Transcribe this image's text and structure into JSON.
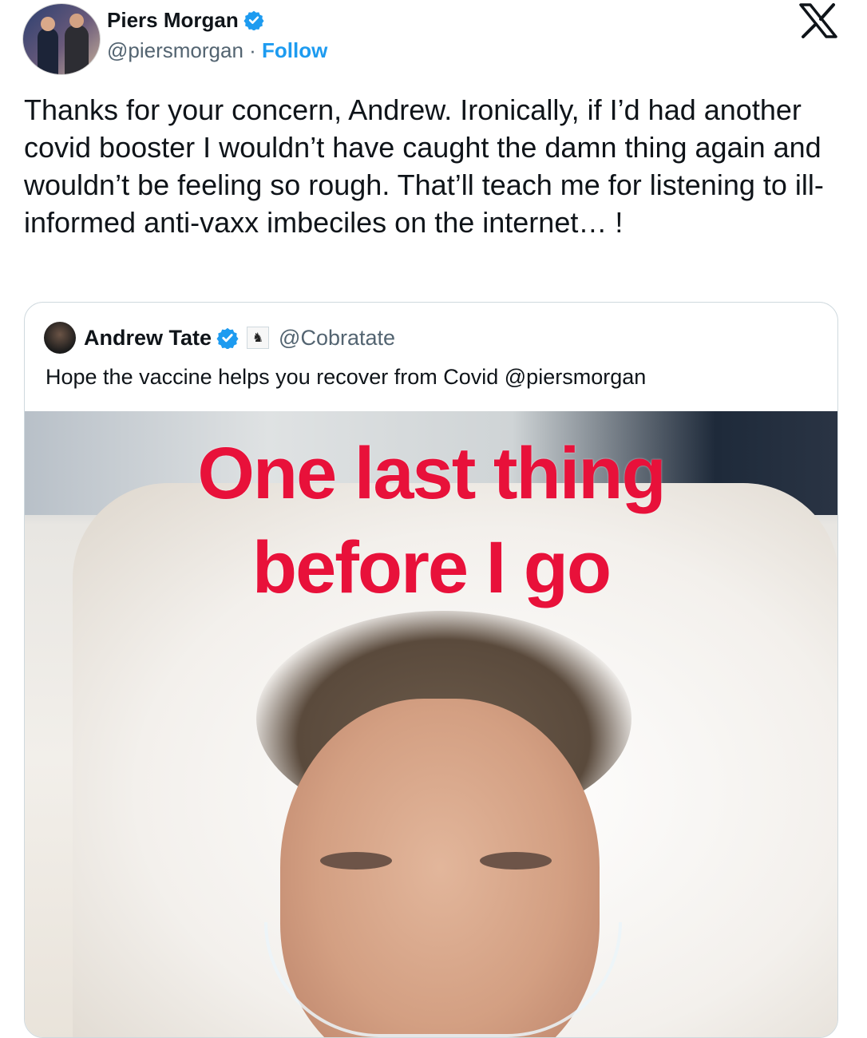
{
  "author": {
    "display_name": "Piers Morgan",
    "handle": "@piersmorgan",
    "separator": "·",
    "follow_label": "Follow"
  },
  "tweet": {
    "text": "Thanks for your concern, Andrew. Ironically, if I’d had another covid booster I wouldn’t have caught the damn thing again and wouldn’t be feeling so rough. That’ll teach me for listening to ill-informed anti-vaxx imbeciles on the internet… !"
  },
  "quoted": {
    "display_name": "Andrew Tate",
    "handle": "@Cobratate",
    "text": "Hope the vaccine helps you recover from Covid @piersmorgan",
    "media_overlay": {
      "line1": "One last thing",
      "line2": "before I go"
    }
  },
  "icons": {
    "verified": "verified-badge-icon",
    "platform": "x-logo-icon",
    "affiliate": "affiliate-badge-icon"
  },
  "colors": {
    "accent": "#1d9bf0",
    "overlay_text": "#e8113a",
    "secondary_text": "#536471"
  }
}
